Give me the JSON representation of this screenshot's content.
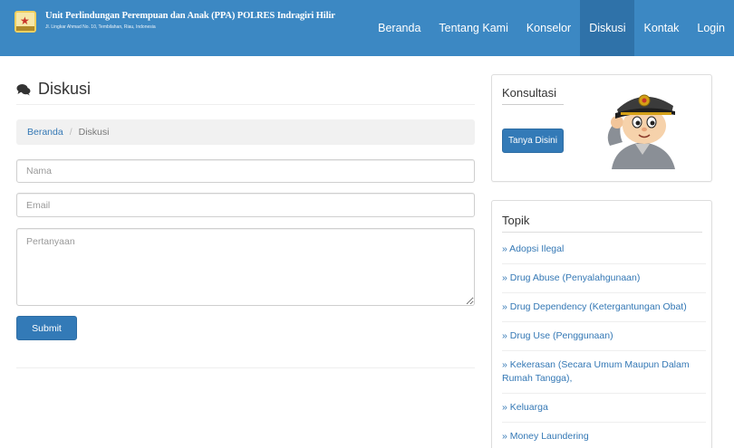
{
  "brand": {
    "title": "Unit Perlindungan Perempuan dan Anak (PPA) POLRES Indragiri Hilir",
    "subtitle": "Jl. Lingkar Ahmad No. 10, Tembilahan, Riau, Indonesia"
  },
  "nav": {
    "items": [
      "Beranda",
      "Tentang Kami",
      "Konselor",
      "Diskusi",
      "Kontak",
      "Login"
    ],
    "active": "Diskusi"
  },
  "page": {
    "title": "Diskusi",
    "icon": "comments-icon"
  },
  "breadcrumb": {
    "home": "Beranda",
    "separator": "/",
    "current": "Diskusi"
  },
  "form": {
    "nama_placeholder": "Nama",
    "email_placeholder": "Email",
    "pertanyaan_placeholder": "Pertanyaan",
    "submit_label": "Submit"
  },
  "konsultasi": {
    "title": "Konsultasi",
    "button_label": "Tanya Disini"
  },
  "topik": {
    "title": "Topik",
    "items": [
      "» Adopsi Ilegal",
      "» Drug Abuse (Penyalahgunaan)",
      "» Drug Dependency (Ketergantungan Obat)",
      "» Drug Use (Penggunaan)",
      "» Kekerasan (Secara Umum Maupun Dalam Rumah Tangga),",
      "» Keluarga",
      "» Money Laundering"
    ]
  },
  "colors": {
    "navbar": "#3c88c3",
    "nav_active": "#2f72a9",
    "primary_button": "#337ab7",
    "link": "#3478b5"
  }
}
